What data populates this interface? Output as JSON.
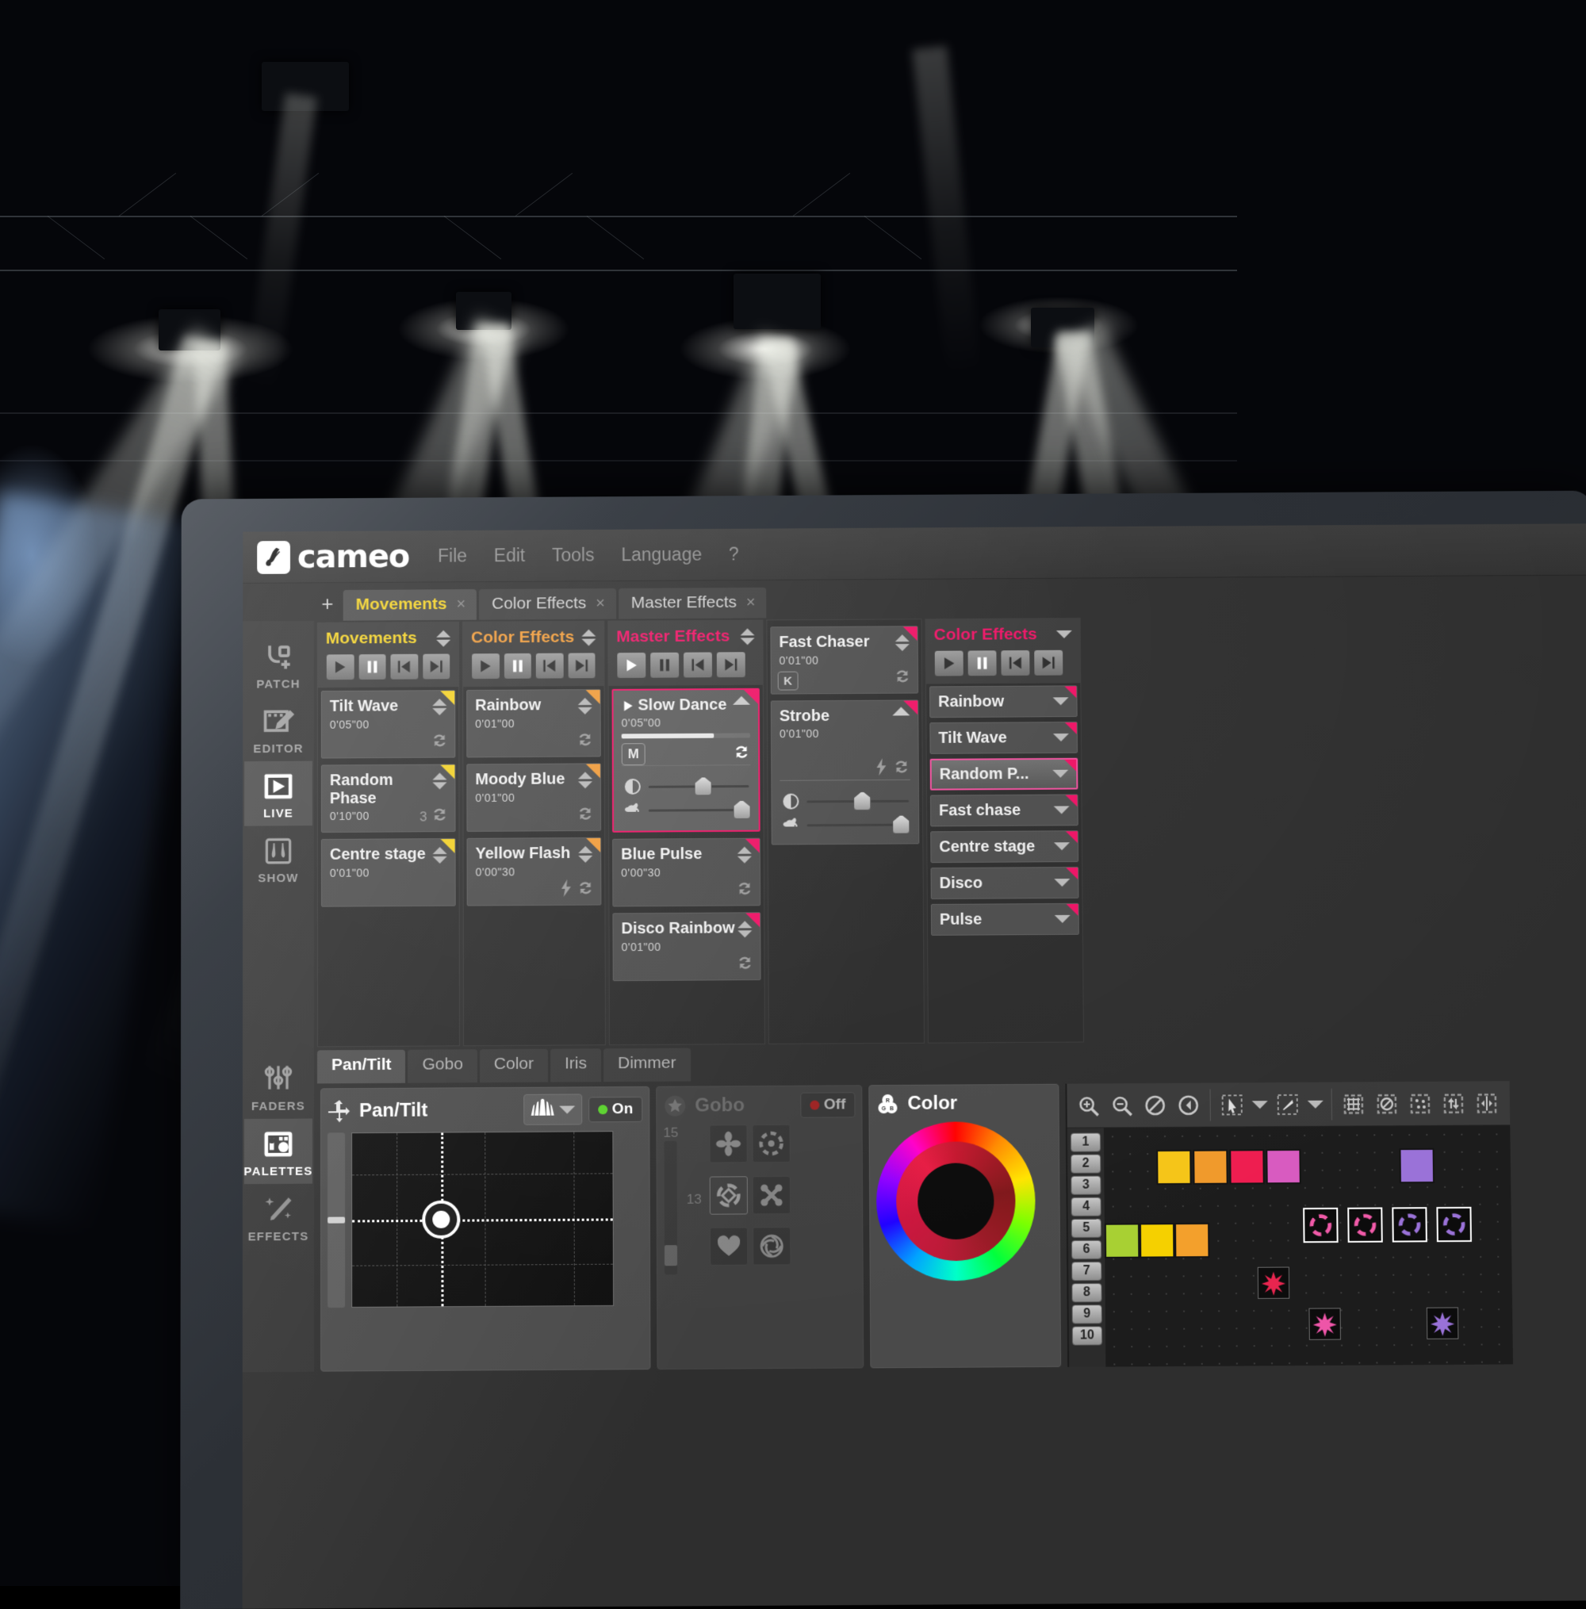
{
  "app": {
    "brand": "cameo",
    "menu": [
      "File",
      "Edit",
      "Tools",
      "Language",
      "?"
    ]
  },
  "tabs": {
    "add_label": "+",
    "items": [
      {
        "label": "Movements",
        "close": "×",
        "active": true
      },
      {
        "label": "Color Effects",
        "close": "×",
        "active": false
      },
      {
        "label": "Master Effects",
        "close": "×",
        "active": false
      }
    ]
  },
  "rail": {
    "top": [
      {
        "label": "PATCH",
        "icon": "patch-icon",
        "active": false
      },
      {
        "label": "EDITOR",
        "icon": "editor-icon",
        "active": false
      },
      {
        "label": "LIVE",
        "icon": "live-play-icon",
        "active": true
      },
      {
        "label": "SHOW",
        "icon": "show-curtain-icon",
        "active": false
      }
    ],
    "bottom": [
      {
        "label": "FADERS",
        "icon": "faders-icon",
        "active": false
      },
      {
        "label": "PALETTES",
        "icon": "palettes-icon",
        "active": true
      },
      {
        "label": "EFFECTS",
        "icon": "effects-wand-icon",
        "active": false
      }
    ]
  },
  "transport": {
    "play": "play-icon",
    "pause": "pause-icon",
    "prev": "skip-back-icon",
    "next": "skip-forward-icon"
  },
  "columns": [
    {
      "title": "Movements",
      "accent": "#f2d024",
      "play_lit": false,
      "cues": [
        {
          "name": "Tilt Wave",
          "time": "0'05\"00",
          "loop": true,
          "loop_count": "",
          "badge": "",
          "bolt": false
        },
        {
          "name": "Random Phase",
          "time": "0'10\"00",
          "loop": true,
          "loop_count": "3",
          "badge": "",
          "bolt": false
        },
        {
          "name": "Centre stage",
          "time": "0'01\"00",
          "loop": true,
          "loop_count": "",
          "badge": "",
          "bolt": false
        }
      ]
    },
    {
      "title": "Color Effects",
      "accent": "#ef9a38",
      "play_lit": false,
      "cues": [
        {
          "name": "Rainbow",
          "time": "0'01\"00",
          "loop": true,
          "loop_count": "",
          "badge": "",
          "bolt": false
        },
        {
          "name": "Moody Blue",
          "time": "0'01\"00",
          "loop": true,
          "loop_count": "",
          "badge": "",
          "bolt": false
        },
        {
          "name": "Yellow Flash",
          "time": "0'00\"30",
          "loop": true,
          "loop_count": "",
          "badge": "",
          "bolt": true
        }
      ]
    },
    {
      "title": "Master Effects",
      "accent": "#ed1164",
      "play_lit": true,
      "playing_cue": {
        "name": "Slow Dance",
        "time": "0'05\"00",
        "badge": "M",
        "progress_percent": 72,
        "sliders": [
          {
            "icon": "contrast-icon",
            "value_percent": 48
          },
          {
            "icon": "rabbit-speed-icon",
            "value_percent": 86
          }
        ]
      },
      "cues": [
        {
          "name": "Blue Pulse",
          "time": "0'00\"30",
          "loop": true,
          "loop_count": "",
          "badge": "",
          "bolt": false
        },
        {
          "name": "Disco Rainbow",
          "time": "0'01\"00",
          "loop": true,
          "loop_count": "",
          "badge": "",
          "bolt": false
        }
      ]
    },
    {
      "title": "",
      "accent": "#ed1164",
      "cues": [
        {
          "name": "Fast Chaser",
          "time": "0'01\"00",
          "loop": true,
          "loop_count": "",
          "badge": "K",
          "bolt": false
        },
        {
          "name": "Strobe",
          "time": "0'01\"00",
          "loop": true,
          "loop_count": "",
          "badge": "",
          "bolt": true
        }
      ],
      "strobe_sliders": [
        {
          "icon": "contrast-icon",
          "value_percent": 48
        },
        {
          "icon": "rabbit-speed-icon",
          "value_percent": 86
        }
      ]
    }
  ],
  "mini_column": {
    "title": "Color Effects",
    "accent": "#ed1164",
    "items": [
      {
        "label": "Rainbow",
        "selected": false
      },
      {
        "label": "Tilt Wave",
        "selected": false
      },
      {
        "label": "Random P...",
        "selected": true
      },
      {
        "label": "Fast chase",
        "selected": false
      },
      {
        "label": "Centre stage",
        "selected": false
      },
      {
        "label": "Disco",
        "selected": false
      },
      {
        "label": "Pulse",
        "selected": false
      }
    ]
  },
  "subtabs": [
    {
      "label": "Pan/Tilt",
      "active": true
    },
    {
      "label": "Gobo",
      "active": false
    },
    {
      "label": "Color",
      "active": false
    },
    {
      "label": "Iris",
      "active": false
    },
    {
      "label": "Dimmer",
      "active": false
    }
  ],
  "editors": {
    "pan_tilt": {
      "title": "Pan/Tilt",
      "icon": "move-cross-icon",
      "dropdown_icon": "beam-spread-icon",
      "toggle_label": "On",
      "toggle_color": "#57d129",
      "toggle_on": true
    },
    "gobo": {
      "title": "Gobo",
      "icon": "gobo-star-icon",
      "toggle_label": "Off",
      "toggle_color": "#e01b1b",
      "toggle_on": false,
      "slider_value": "15",
      "secondary_value": "13",
      "shapes": [
        "gobo-four-petal-icon",
        "gobo-ring-dots-icon",
        "gobo-diamond-ring-icon",
        "gobo-cross-ball-icon",
        "gobo-heart-icon",
        "gobo-iris-icon"
      ],
      "selected_shape_index": 2
    },
    "color": {
      "title": "Color",
      "icon": "rgb-circles-icon"
    }
  },
  "canvas_toolbar": {
    "groups": [
      [
        "zoom-in-icon",
        "zoom-out-icon",
        "no-zoom-icon",
        "back-arrow-icon"
      ],
      [
        "select-arrow-icon",
        "chevron-down-icon",
        "pen-line-icon",
        "chevron-down-icon"
      ],
      [
        "grid-fill-icon",
        "no-grid-icon",
        "scatter-icon",
        "swap-vertical-icon",
        "mirror-icon"
      ]
    ]
  },
  "canvas": {
    "row_numbers": [
      "1",
      "2",
      "3",
      "4",
      "5",
      "6",
      "7",
      "8",
      "9",
      "10"
    ],
    "swatches_row1": [
      "#f5c518",
      "#f09a2b",
      "#ee1d50",
      "#d85bc0"
    ],
    "swatches_row1_extra": [
      "#9a72d8"
    ],
    "swatches_row2": [
      "#a8d033",
      "#f5d000",
      "#f3a02c"
    ],
    "gobo_icons": [
      "gobo-diamond-ring-icon",
      "gobo-diamond-ring-icon",
      "gobo-diamond-ring-icon",
      "gobo-diamond-ring-icon"
    ],
    "gobo_icon_colors": [
      "#f05aa8",
      "#f05aa8",
      "#9a72d8",
      "#9a72d8"
    ],
    "stars": [
      "#e8254f",
      "#ee55a8",
      "#9a72d8"
    ]
  }
}
